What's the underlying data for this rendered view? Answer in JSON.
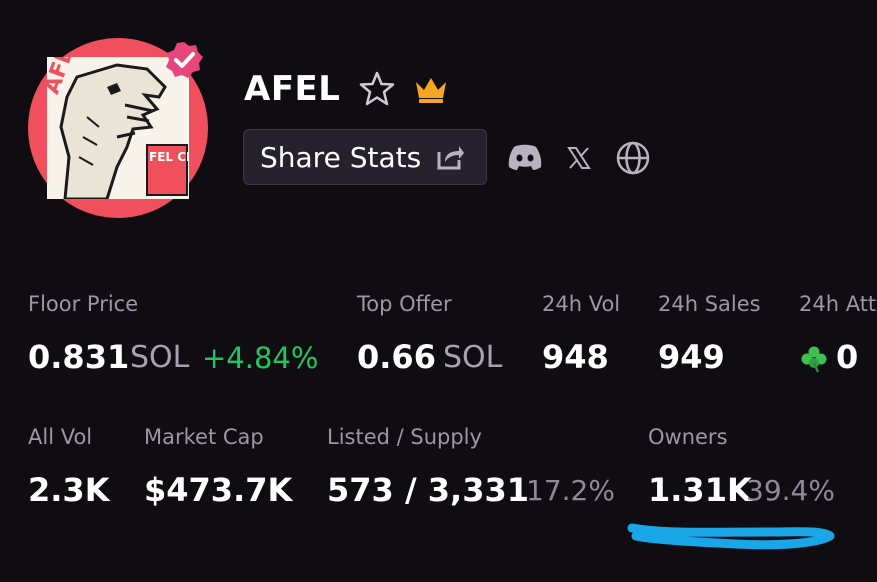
{
  "collection": {
    "name": "AFEL",
    "avatar_text_top": "AFEL",
    "avatar_text_side": "FEL CLUB"
  },
  "actions": {
    "share_label": "Share Stats"
  },
  "icons": {
    "verified": "verified-check-icon",
    "favorite": "star-icon",
    "crown": "crown-icon",
    "share": "share-icon",
    "discord": "discord-icon",
    "x": "x-icon",
    "website": "globe-icon",
    "clover": "clover-icon"
  },
  "colors": {
    "accent_pink": "#e8457a",
    "ring": "#f0505d",
    "positive": "#22c55e",
    "crown": "#f5a623",
    "annotation": "#1aa7e8"
  },
  "stats_row1": {
    "floor_price": {
      "label": "Floor Price",
      "value": "0.831",
      "unit": "SOL",
      "change": "+4.84%"
    },
    "top_offer": {
      "label": "Top Offer",
      "value": "0.66",
      "unit": "SOL"
    },
    "vol_24h": {
      "label": "24h Vol",
      "value": "948"
    },
    "sales_24h": {
      "label": "24h Sales",
      "value": "949"
    },
    "att_24h": {
      "label": "24h Att",
      "value": "0"
    }
  },
  "stats_row2": {
    "all_vol": {
      "label": "All Vol",
      "value": "2.3K"
    },
    "market_cap": {
      "label": "Market Cap",
      "value": "$473.7K"
    },
    "listed_supply": {
      "label": "Listed / Supply",
      "value": "573 / 3,331",
      "pct": "17.2%"
    },
    "owners": {
      "label": "Owners",
      "value": "1.31K",
      "pct": "39.4%"
    }
  }
}
